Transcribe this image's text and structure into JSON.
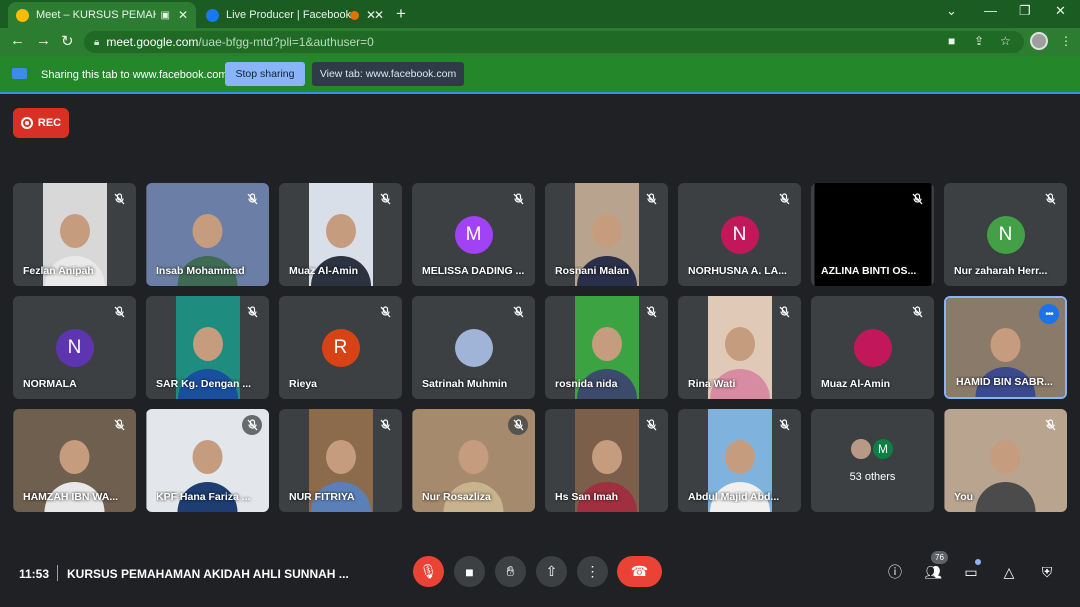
{
  "browser": {
    "tabs": [
      {
        "title": "Meet – KURSUS PEMAHAMAN",
        "active": true,
        "favicon_color": "#fbbc04"
      },
      {
        "title": "Live Producer | Facebook",
        "active": false,
        "favicon_color": "#1877f2"
      },
      {
        "title": "",
        "active": false,
        "favicon_color": "#e37400"
      }
    ],
    "new_tab": "+",
    "window_controls": {
      "dropdown": "⌄",
      "minimize": "—",
      "maximize": "❐",
      "close": "✕"
    },
    "url_host": "meet.google.com",
    "url_path": "/uae-bfgg-mtd?pli=1&authuser=0"
  },
  "infobar": {
    "message": "Sharing this tab to www.facebook.com",
    "stop_label": "Stop sharing",
    "view_label": "View tab: www.facebook.com"
  },
  "meet": {
    "rec_label": "REC",
    "participants": [
      {
        "name": "Fezlan Anipah",
        "type": "video",
        "bg": "#d8d8d8",
        "shirt": "#e9e9e9",
        "vw": 64
      },
      {
        "name": "Insab Mohammad",
        "type": "video",
        "bg": "#6b7fa6",
        "shirt": "#3f6b55",
        "vw": 123
      },
      {
        "name": "Muaz Al-Amin",
        "type": "video",
        "bg": "#d9dfe8",
        "shirt": "#2b3340",
        "vw": 64
      },
      {
        "name": "MELISSA DADING ...",
        "type": "avatar",
        "initial": "M",
        "color": "#a142f4"
      },
      {
        "name": "Rosnani Malan",
        "type": "video",
        "bg": "#b8a48e",
        "shirt": "#2a2f4a",
        "vw": 64
      },
      {
        "name": "NORHUSNA A. LA...",
        "type": "avatar",
        "initial": "N",
        "color": "#c2185b"
      },
      {
        "name": "AZLINA BINTI OS...",
        "type": "black"
      },
      {
        "name": "Nur zaharah Herr...",
        "type": "avatar",
        "initial": "N",
        "color": "#43a047"
      },
      {
        "name": "NORMALA",
        "type": "avatar",
        "initial": "N",
        "color": "#5e35b1"
      },
      {
        "name": "SAR Kg. Dengan ...",
        "type": "video",
        "bg": "#1e8c7e",
        "shirt": "#1a4fa0",
        "vw": 64
      },
      {
        "name": "Rieya",
        "type": "avatar",
        "initial": "R",
        "color": "#d84315"
      },
      {
        "name": "Satrinah Muhmin",
        "type": "avatar",
        "initial": "",
        "color": "#9fb4d6"
      },
      {
        "name": "rosnida nida",
        "type": "video",
        "bg": "#3ba341",
        "shirt": "#3c4a6b",
        "vw": 64
      },
      {
        "name": "Rina Wati",
        "type": "video",
        "bg": "#e1c9b8",
        "shirt": "#d88ca3",
        "vw": 64
      },
      {
        "name": "Muaz Al-Amin",
        "type": "avatar",
        "initial": "",
        "color": "#c2185b"
      },
      {
        "name": "HAMID BIN SABR...",
        "type": "video",
        "bg": "#8a7a6a",
        "shirt": "#3b4a8c",
        "vw": 123,
        "speaking": true
      },
      {
        "name": "HAMZAH IBN WA...",
        "type": "video",
        "bg": "#6f5f4f",
        "shirt": "#e8e8e8",
        "vw": 123
      },
      {
        "name": "KPF Hana Fariza ...",
        "type": "video",
        "bg": "#e3e6ea",
        "shirt": "#1d3d73",
        "vw": 123,
        "mic_bubble": true
      },
      {
        "name": "NUR FITRIYA",
        "type": "video",
        "bg": "#8c6a4c",
        "shirt": "#5b80b8",
        "vw": 64
      },
      {
        "name": "Nur Rosazliza",
        "type": "video",
        "bg": "#a58a6e",
        "shirt": "#c9b28e",
        "vw": 123,
        "mic_bubble": true
      },
      {
        "name": "Hs San Imah",
        "type": "video",
        "bg": "#7c5f4a",
        "shirt": "#a03040",
        "vw": 64
      },
      {
        "name": "Abdul Majid Abd...",
        "type": "video",
        "bg": "#7fb2dc",
        "shirt": "#f0f0f0",
        "vw": 64
      },
      {
        "name": "",
        "type": "others",
        "count_label": "53 others",
        "initial": "M"
      },
      {
        "name": "You",
        "type": "video",
        "bg": "#b9a58f",
        "shirt": "#4b4b4b",
        "vw": 123
      }
    ]
  },
  "bottom": {
    "time": "11:53",
    "meeting_title": "KURSUS PEMAHAMAN AKIDAH AHLI SUNNAH ...",
    "people_count": "76"
  },
  "colors": {
    "meet_bg": "#202124",
    "tile_bg": "#3c4043",
    "danger": "#ea4335",
    "accent": "#8ab4f8"
  },
  "icons": {
    "mic_off": "mic-off-icon",
    "camera": "camera-icon",
    "raise_hand": "raise-hand-icon",
    "present": "present-icon",
    "more": "more-options-icon",
    "end_call": "end-call-icon",
    "info": "info-icon",
    "people": "people-icon",
    "chat": "chat-icon",
    "activities": "activities-icon",
    "host_controls": "host-controls-icon"
  }
}
